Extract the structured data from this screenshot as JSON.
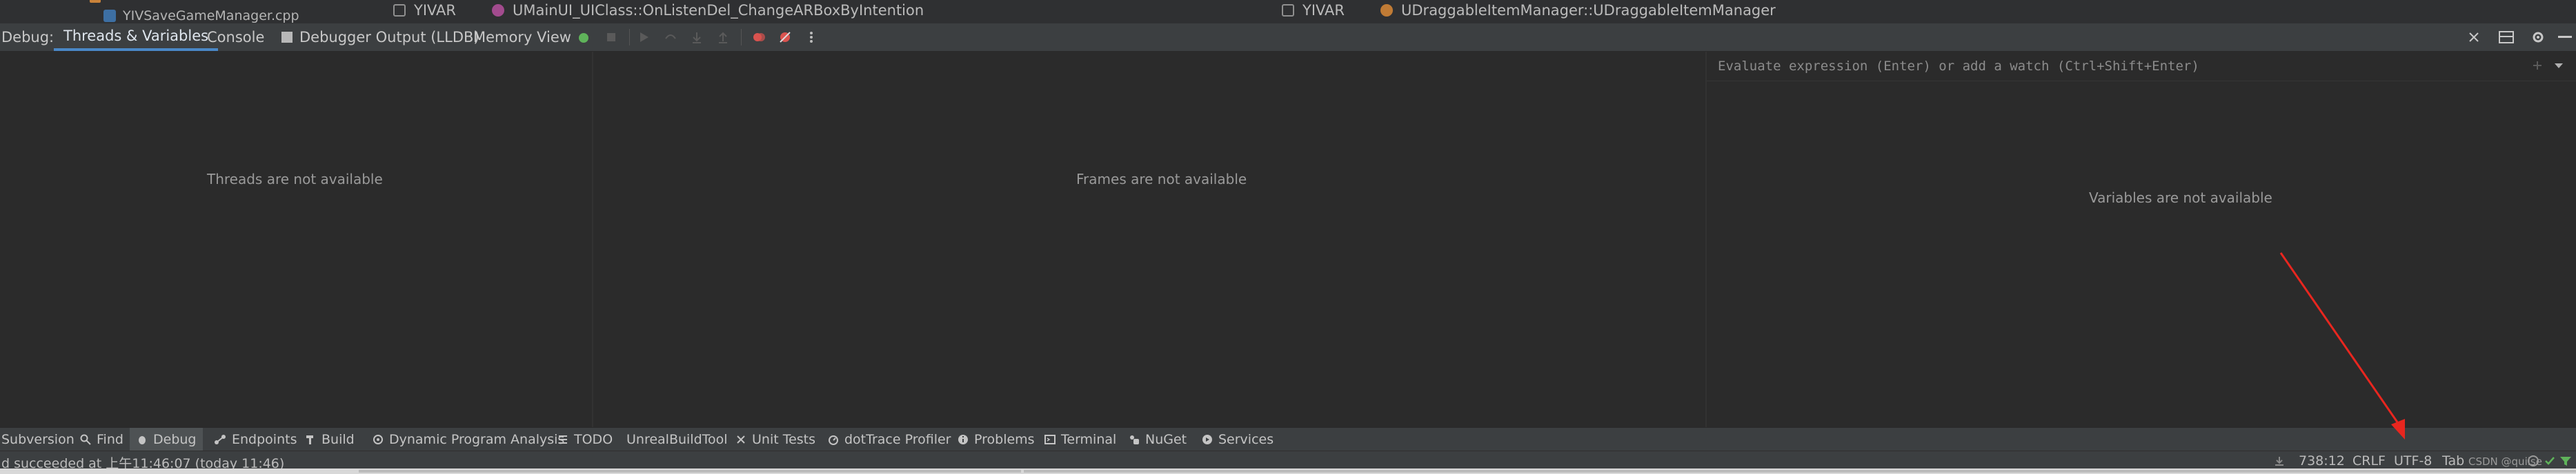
{
  "top": {
    "file_name": "YIVSaveGameManager.cpp",
    "breadcrumb_left": {
      "module": "YIVAR",
      "symbol": "UMainUI_UIClass::OnListenDel_ChangeARBoxByIntention"
    },
    "breadcrumb_right": {
      "module": "YIVAR",
      "symbol": "UDraggableItemManager::UDraggableItemManager"
    }
  },
  "debug": {
    "label": "Debug:",
    "tabs": [
      {
        "label": "Threads & Variables",
        "active": true
      },
      {
        "label": "Console",
        "active": false
      },
      {
        "label": "Debugger Output (LLDB)",
        "active": false
      },
      {
        "label": "Memory View",
        "active": false
      }
    ]
  },
  "panels": {
    "threads_empty": "Threads are not available",
    "frames_empty": "Frames are not available",
    "variables_empty": "Variables are not available",
    "watch_placeholder": "Evaluate expression (Enter) or add a watch (Ctrl+Shift+Enter)"
  },
  "tool_windows": [
    {
      "label": "Subversion",
      "icon": "none",
      "active": false
    },
    {
      "label": "Find",
      "icon": "search-icon",
      "active": false
    },
    {
      "label": "Debug",
      "icon": "bug-icon",
      "active": true
    },
    {
      "label": "Endpoints",
      "icon": "endpoints-icon",
      "active": false
    },
    {
      "label": "Build",
      "icon": "hammer-icon",
      "active": false
    },
    {
      "label": "Dynamic Program Analysis",
      "icon": "analysis-icon",
      "active": false
    },
    {
      "label": "TODO",
      "icon": "list-icon",
      "active": false
    },
    {
      "label": "UnrealBuildTool",
      "icon": "none",
      "active": false
    },
    {
      "label": "Unit Tests",
      "icon": "unit-tests-icon",
      "active": false
    },
    {
      "label": "dotTrace Profiler",
      "icon": "profiler-icon",
      "active": false
    },
    {
      "label": "Problems",
      "icon": "info-icon",
      "active": false
    },
    {
      "label": "Terminal",
      "icon": "terminal-icon",
      "active": false
    },
    {
      "label": "NuGet",
      "icon": "nuget-icon",
      "active": false
    },
    {
      "label": "Services",
      "icon": "services-icon",
      "active": false
    }
  ],
  "status": {
    "message": "d succeeded at 上午11:46:07 (today 11:46)",
    "position": "738:12",
    "line_ending": "CRLF",
    "encoding": "UTF-8",
    "indent": "Tab",
    "watermark": "CSDN @quilse"
  },
  "colors": {
    "accent": "#4a88c7",
    "background": "#2b2b2b",
    "annotation": "#e8261f"
  }
}
